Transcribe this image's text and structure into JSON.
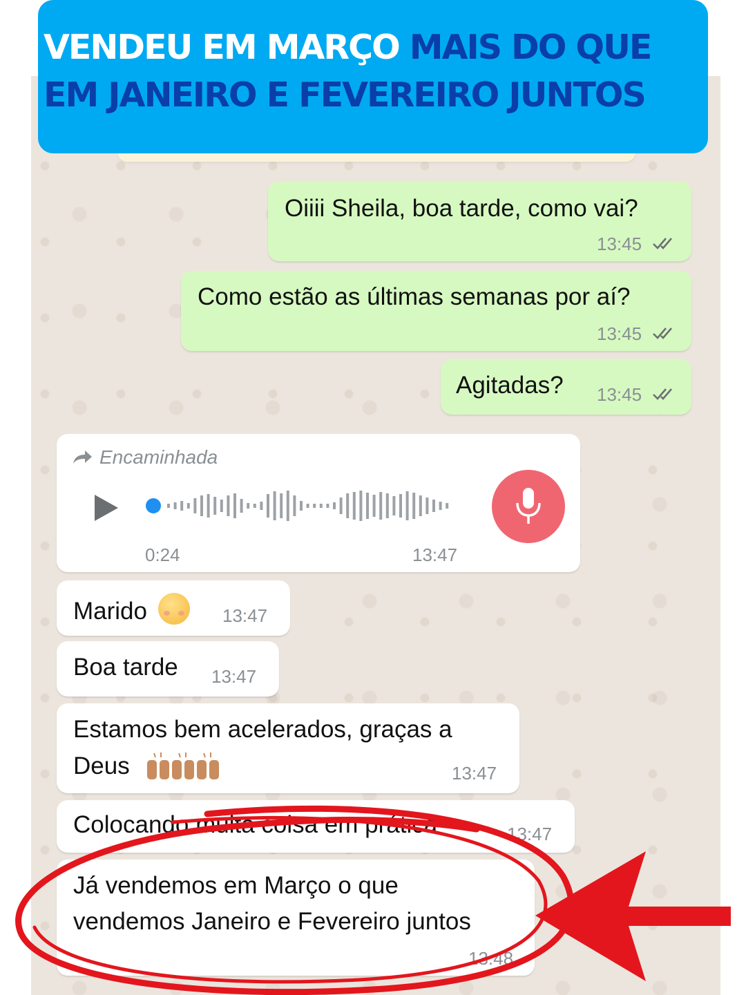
{
  "banner": {
    "line1_white": "VENDEU EM MARÇO ",
    "line1_blue": "MAIS DO QUE",
    "line2_blue": "EM JANEIRO E FEVEREIRO JUNTOS"
  },
  "colors": {
    "banner_bg": "#00aaf2",
    "banner_white_text": "#ffffff",
    "banner_blue_text": "#0a3ea8",
    "outgoing_bubble": "#d6f9c1",
    "incoming_bubble": "#ffffff",
    "chat_background": "#ece5dd",
    "mic_button": "#f06670",
    "annotation_red": "#e3161d",
    "read_ticks": "#6b6f72"
  },
  "messages": {
    "m1": {
      "text": "Oiiii Sheila, boa tarde, como vai?",
      "time": "13:45",
      "status_icon": "double-check-icon"
    },
    "m2": {
      "text": "Como estão as últimas semanas por aí?",
      "time": "13:45",
      "status_icon": "double-check-icon"
    },
    "m3": {
      "text": "Agitadas?",
      "time": "13:45",
      "status_icon": "double-check-icon"
    },
    "audio": {
      "forwarded_label": "Encaminhada",
      "duration": "0:24",
      "time": "13:47",
      "icons": [
        "forward-arrow-icon",
        "play-icon",
        "microphone-icon"
      ]
    },
    "m4": {
      "text": "Marido",
      "emoji": "smiling-face-emoji",
      "time": "13:47"
    },
    "m5": {
      "text": "Boa tarde",
      "time": "13:47"
    },
    "m6": {
      "line1": "Estamos bem acelerados, graças a",
      "line2": "Deus",
      "emoji": "raising-hands-emoji",
      "time": "13:47"
    },
    "m7": {
      "text": "Colocando muita coisa em prática",
      "time": "13:47"
    },
    "m8": {
      "line1": "Já vendemos em Março o que",
      "line2": "vendemos Janeiro e Fevereiro juntos",
      "time": "13:48"
    }
  },
  "annotation": {
    "shapes": [
      "red-ellipse",
      "red-arrow"
    ]
  }
}
